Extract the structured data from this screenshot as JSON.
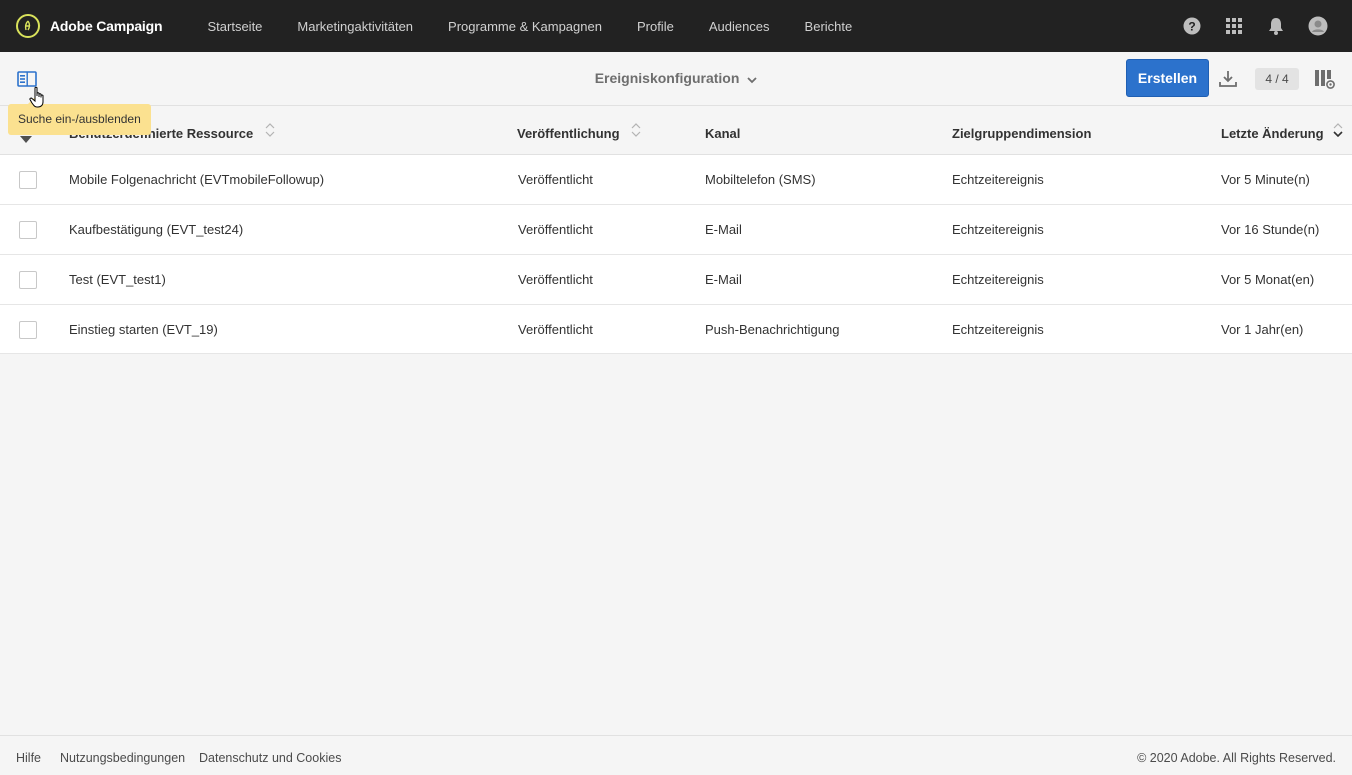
{
  "app": {
    "brand_name": "Adobe Campaign",
    "accent_color": "#2c72cc",
    "logo_color": "#d9e25b"
  },
  "nav": {
    "items": [
      {
        "label": "Startseite"
      },
      {
        "label": "Marketingaktivitäten"
      },
      {
        "label": "Programme & Kampagnen"
      },
      {
        "label": "Profile"
      },
      {
        "label": "Audiences"
      },
      {
        "label": "Berichte"
      }
    ],
    "icons": [
      "help-icon",
      "apps-grid-icon",
      "bell-icon",
      "user-avatar-icon"
    ]
  },
  "toolbar": {
    "title": "Ereigniskonfiguration",
    "create_label": "Erstellen",
    "count": "4 / 4",
    "icons": [
      "search-toggle-icon",
      "download-icon",
      "columns-config-icon"
    ]
  },
  "tooltip": {
    "text": "Suche ein-/ausblenden"
  },
  "table": {
    "columns": [
      {
        "label": "Benutzerdefinierte Ressource"
      },
      {
        "label": "Veröffentlichung"
      },
      {
        "label": "Kanal"
      },
      {
        "label": "Zielgruppendimension"
      },
      {
        "label": "Letzte Änderung"
      }
    ],
    "rows": [
      {
        "resource": "Mobile Folgenachricht (EVTmobileFollowup)",
        "publication": "Veröffentlicht",
        "channel": "Mobiltelefon (SMS)",
        "dimension": "Echtzeitereignis",
        "modified": "Vor 5 Minute(n)"
      },
      {
        "resource": "Kaufbestätigung (EVT_test24)",
        "publication": "Veröffentlicht",
        "channel": "E-Mail",
        "dimension": "Echtzeitereignis",
        "modified": "Vor 16 Stunde(n)"
      },
      {
        "resource": "Test (EVT_test1)",
        "publication": "Veröffentlicht",
        "channel": "E-Mail",
        "dimension": "Echtzeitereignis",
        "modified": "Vor 5 Monat(en)"
      },
      {
        "resource": "Einstieg starten (EVT_19)",
        "publication": "Veröffentlicht",
        "channel": "Push-Benachrichtigung",
        "dimension": "Echtzeitereignis",
        "modified": "Vor 1 Jahr(en)"
      }
    ]
  },
  "footer": {
    "links": [
      {
        "label": "Hilfe"
      },
      {
        "label": "Nutzungsbedingungen"
      },
      {
        "label": "Datenschutz und Cookies"
      }
    ],
    "copyright": "© 2020 Adobe. All Rights Reserved."
  }
}
